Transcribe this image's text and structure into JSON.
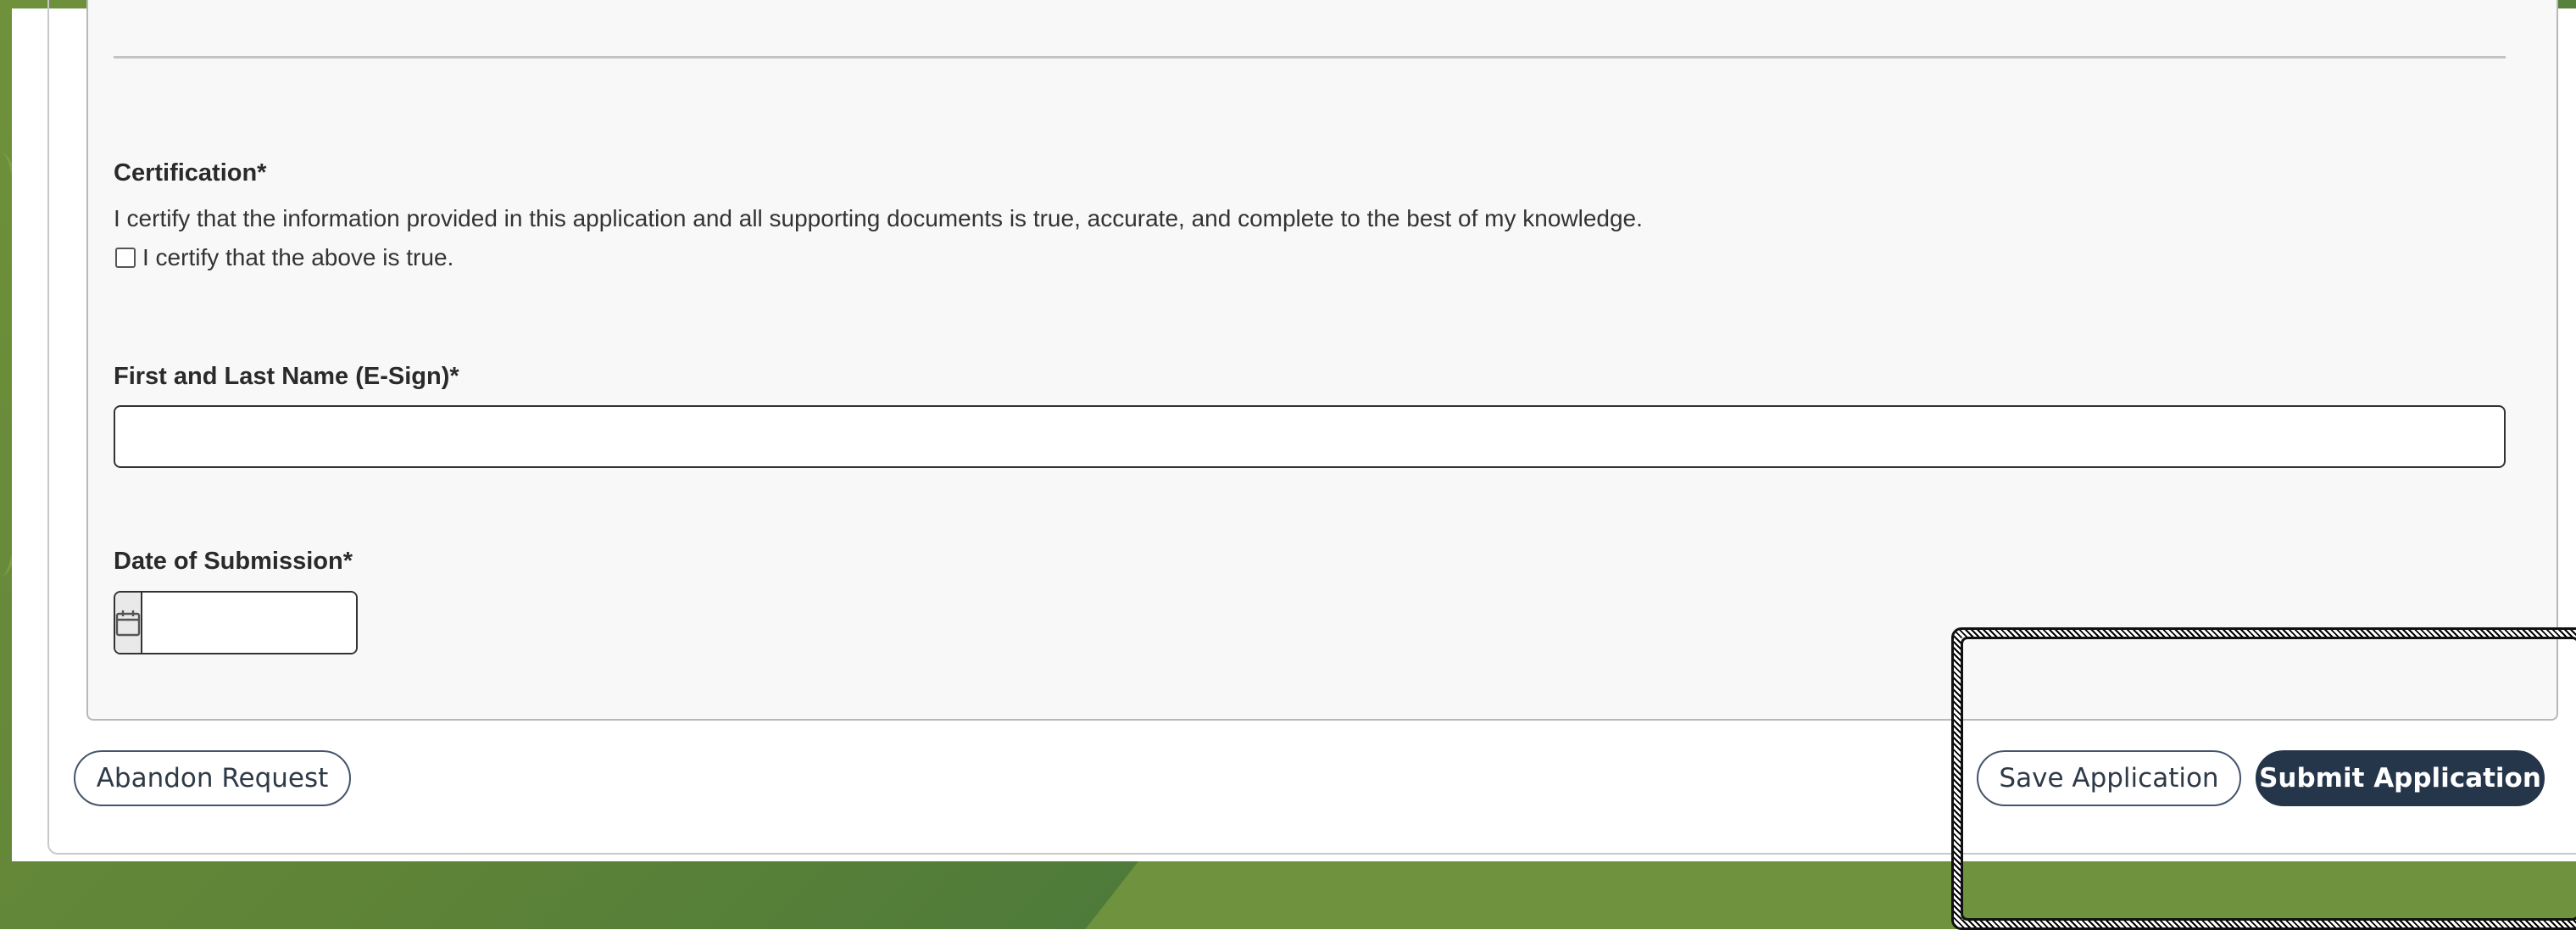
{
  "certification": {
    "heading": "Certification*",
    "statement": "I certify that the information provided in this application and all supporting documents is true, accurate, and complete to the best of my knowledge.",
    "checkbox_label": "I certify that the above is true.",
    "checked": false
  },
  "esign": {
    "label": "First and Last Name (E-Sign)*",
    "value": "",
    "placeholder": ""
  },
  "submission_date": {
    "label": "Date of Submission*",
    "value": "",
    "icon": "calendar-icon"
  },
  "actions": {
    "abandon_label": "Abandon Request",
    "save_label": "Save Application",
    "submit_label": "Submit Application"
  },
  "colors": {
    "primary_button": "#25354a",
    "background_green": "#5f8437",
    "panel": "#f8f8f8"
  }
}
